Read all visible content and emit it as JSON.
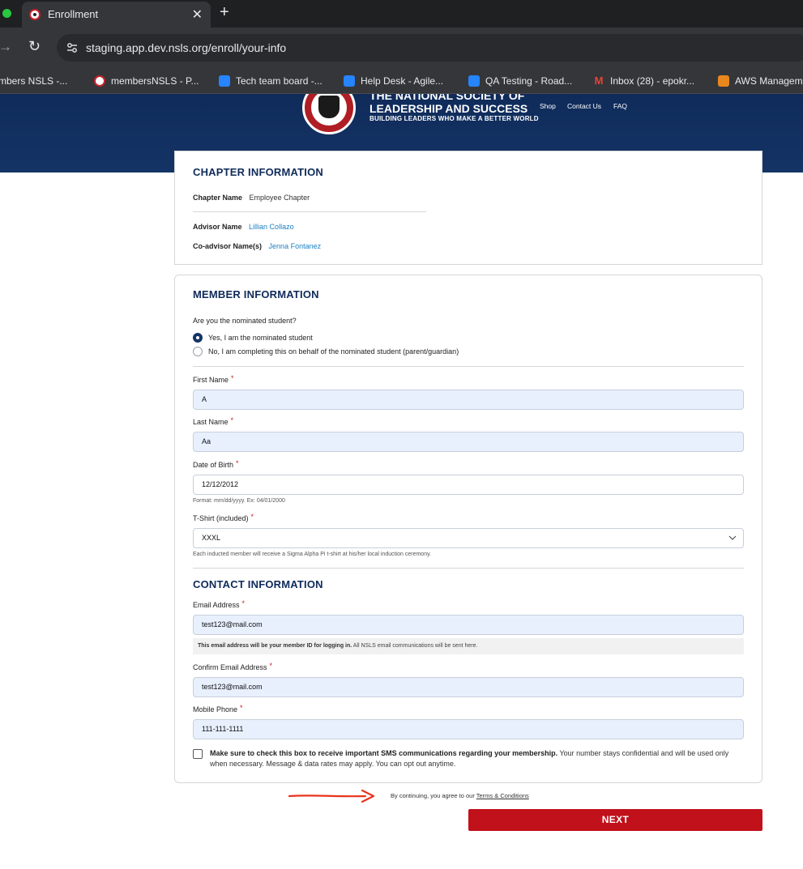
{
  "browser": {
    "tab_title": "Enrollment",
    "url": "staging.app.dev.nsls.org/enroll/your-info",
    "bookmarks": [
      {
        "label": "mbers NSLS -...",
        "icon": "nsls-icon"
      },
      {
        "label": "membersNSLS - P...",
        "icon": "nsls-icon"
      },
      {
        "label": "Tech team board -...",
        "icon": "jira-icon"
      },
      {
        "label": "Help Desk - Agile...",
        "icon": "jira-icon"
      },
      {
        "label": "QA Testing - Road...",
        "icon": "jira-icon"
      },
      {
        "label": "Inbox (28) - epokr...",
        "icon": "gmail-icon"
      },
      {
        "label": "AWS Managem",
        "icon": "aws-icon"
      }
    ]
  },
  "header": {
    "logo_line1": "THE NATIONAL SOCIETY OF",
    "logo_line2": "LEADERSHIP AND SUCCESS",
    "logo_line3": "BUILDING LEADERS WHO MAKE A BETTER WORLD",
    "nav": [
      "Shop",
      "Contact Us",
      "FAQ"
    ]
  },
  "chapter": {
    "title": "CHAPTER INFORMATION",
    "chapter_name_label": "Chapter Name",
    "chapter_name": "Employee Chapter",
    "advisor_label": "Advisor Name",
    "advisor": "Lillian Collazo",
    "coadvisor_label": "Co-advisor Name(s)",
    "coadvisor": "Jenna Fontanez"
  },
  "member": {
    "title": "MEMBER INFORMATION",
    "nominated_question": "Are you the nominated student?",
    "option_yes": "Yes, I am the nominated student",
    "option_no": "No, I am completing this on behalf of the nominated student (parent/guardian)",
    "first_name_label": "First Name",
    "first_name": "A",
    "last_name_label": "Last Name",
    "last_name": "Aa",
    "dob_label": "Date of Birth",
    "dob": "12/12/2012",
    "dob_hint": "Format: mm/dd/yyyy. Ex: 04/01/2000",
    "tshirt_label": "T-Shirt (included)",
    "tshirt": "XXXL",
    "tshirt_hint": "Each inducted member will receive a Sigma Alpha Pi t-shirt at his/her local induction ceremony.",
    "required_mark": "*"
  },
  "contact": {
    "title": "CONTACT INFORMATION",
    "email_label": "Email Address",
    "email": "test123@mail.com",
    "email_info_bold": "This email address will be your member ID for logging in.",
    "email_info_rest": " All NSLS email communications will be sent here.",
    "confirm_email_label": "Confirm Email Address",
    "confirm_email": "test123@mail.com",
    "phone_label": "Mobile Phone",
    "phone": "111-111-1111",
    "sms_bold": "Make sure to check this box to receive important SMS communications regarding your membership.",
    "sms_rest": " Your number stays confidential and will be used only when necessary. Message & data rates may apply. You can opt out anytime."
  },
  "footer": {
    "terms_prefix": "By continuing, you agree to our ",
    "terms_link": "Terms & Conditions",
    "next_label": "NEXT"
  },
  "colors": {
    "brand_navy": "#143466",
    "next_red": "#c1111a",
    "link_blue": "#1d7fc4",
    "annotation_arrow": "#e8341c"
  }
}
